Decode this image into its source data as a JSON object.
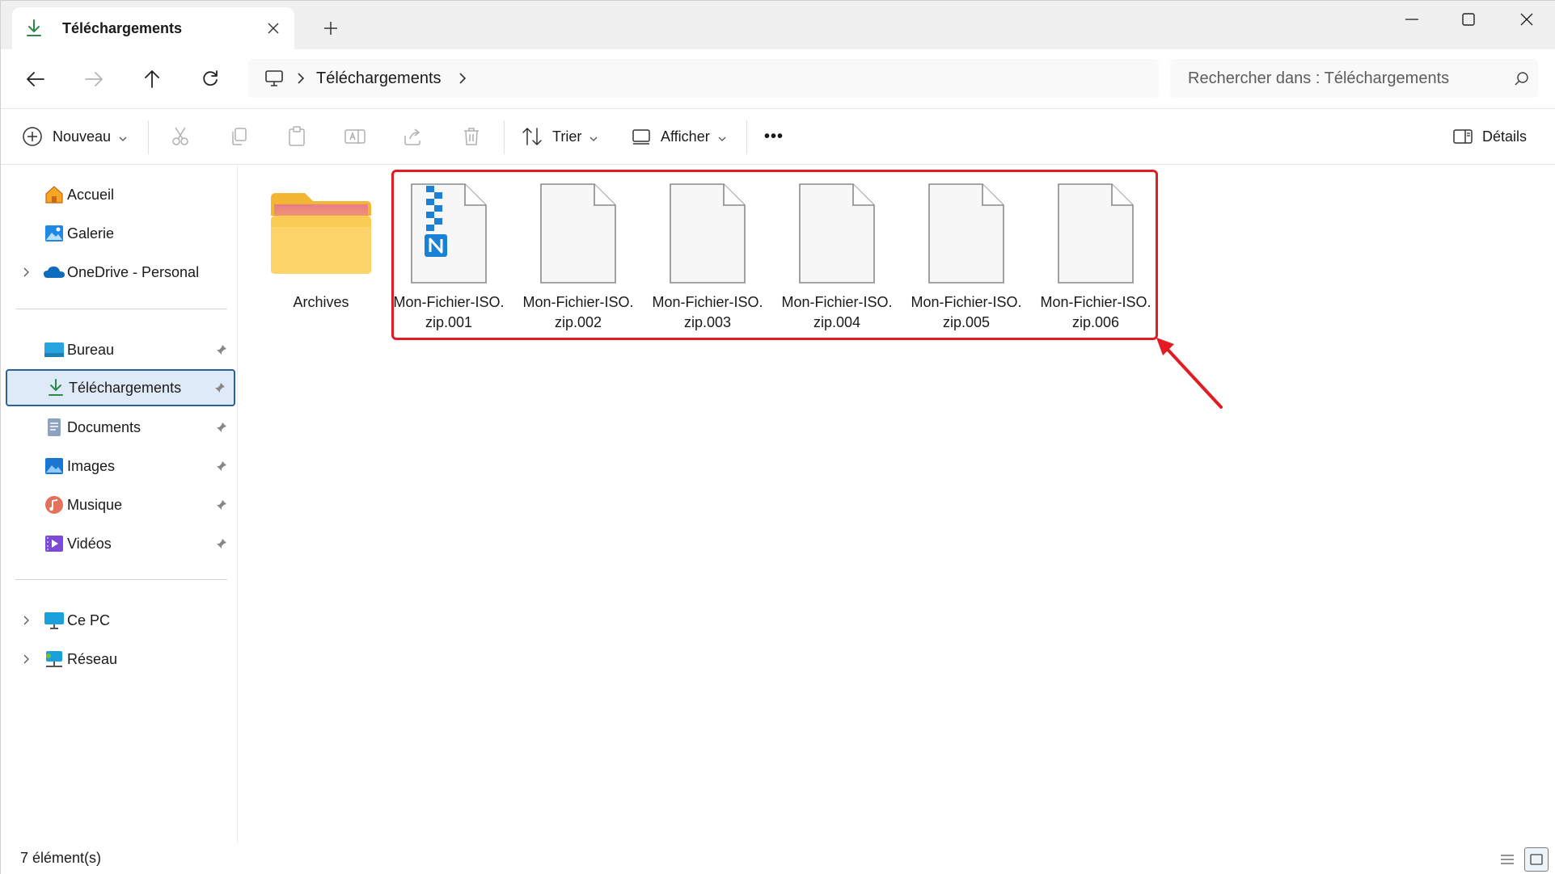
{
  "window": {
    "tab_title": "Téléchargements",
    "new_tab_symbol": "+",
    "controls": [
      "minimize-icon",
      "maximize-icon",
      "close-icon"
    ]
  },
  "address_bar": {
    "crumbs": [
      "Téléchargements"
    ],
    "search_placeholder": "Rechercher dans : Téléchargements"
  },
  "command_bar": {
    "new_label": "Nouveau",
    "sort_label": "Trier",
    "view_label": "Afficher",
    "more_label": "•••",
    "details_label": "Détails"
  },
  "sidebar": {
    "top_items": [
      {
        "label": "Accueil",
        "icon": "home-icon"
      },
      {
        "label": "Galerie",
        "icon": "gallery-icon"
      },
      {
        "label": "OneDrive - Personal",
        "icon": "onedrive-icon",
        "expandable": true
      }
    ],
    "quick_access": [
      {
        "label": "Bureau",
        "icon": "desktop-folder-icon",
        "pinned": true
      },
      {
        "label": "Téléchargements",
        "icon": "downloads-icon",
        "pinned": true,
        "selected": true
      },
      {
        "label": "Documents",
        "icon": "documents-icon",
        "pinned": true
      },
      {
        "label": "Images",
        "icon": "pictures-icon",
        "pinned": true
      },
      {
        "label": "Musique",
        "icon": "music-icon",
        "pinned": true
      },
      {
        "label": "Vidéos",
        "icon": "videos-icon",
        "pinned": true
      }
    ],
    "bottom_items": [
      {
        "label": "Ce PC",
        "icon": "this-pc-icon",
        "expandable": true
      },
      {
        "label": "Réseau",
        "icon": "network-icon",
        "expandable": true
      }
    ]
  },
  "files": [
    {
      "line1": "Archives",
      "line2": "",
      "type": "folder"
    },
    {
      "line1": "Mon-Fichier-ISO.",
      "line2": "zip.001",
      "type": "zip-part-app"
    },
    {
      "line1": "Mon-Fichier-ISO.",
      "line2": "zip.002",
      "type": "blank-file"
    },
    {
      "line1": "Mon-Fichier-ISO.",
      "line2": "zip.003",
      "type": "blank-file"
    },
    {
      "line1": "Mon-Fichier-ISO.",
      "line2": "zip.004",
      "type": "blank-file"
    },
    {
      "line1": "Mon-Fichier-ISO.",
      "line2": "zip.005",
      "type": "blank-file"
    },
    {
      "line1": "Mon-Fichier-ISO.",
      "line2": "zip.006",
      "type": "blank-file"
    }
  ],
  "status": {
    "count_text": "7 élément(s)"
  },
  "colors": {
    "highlight_border": "#e31b23",
    "selection_bg": "#dfeaf8",
    "accent_blue": "#0f6cbd"
  }
}
